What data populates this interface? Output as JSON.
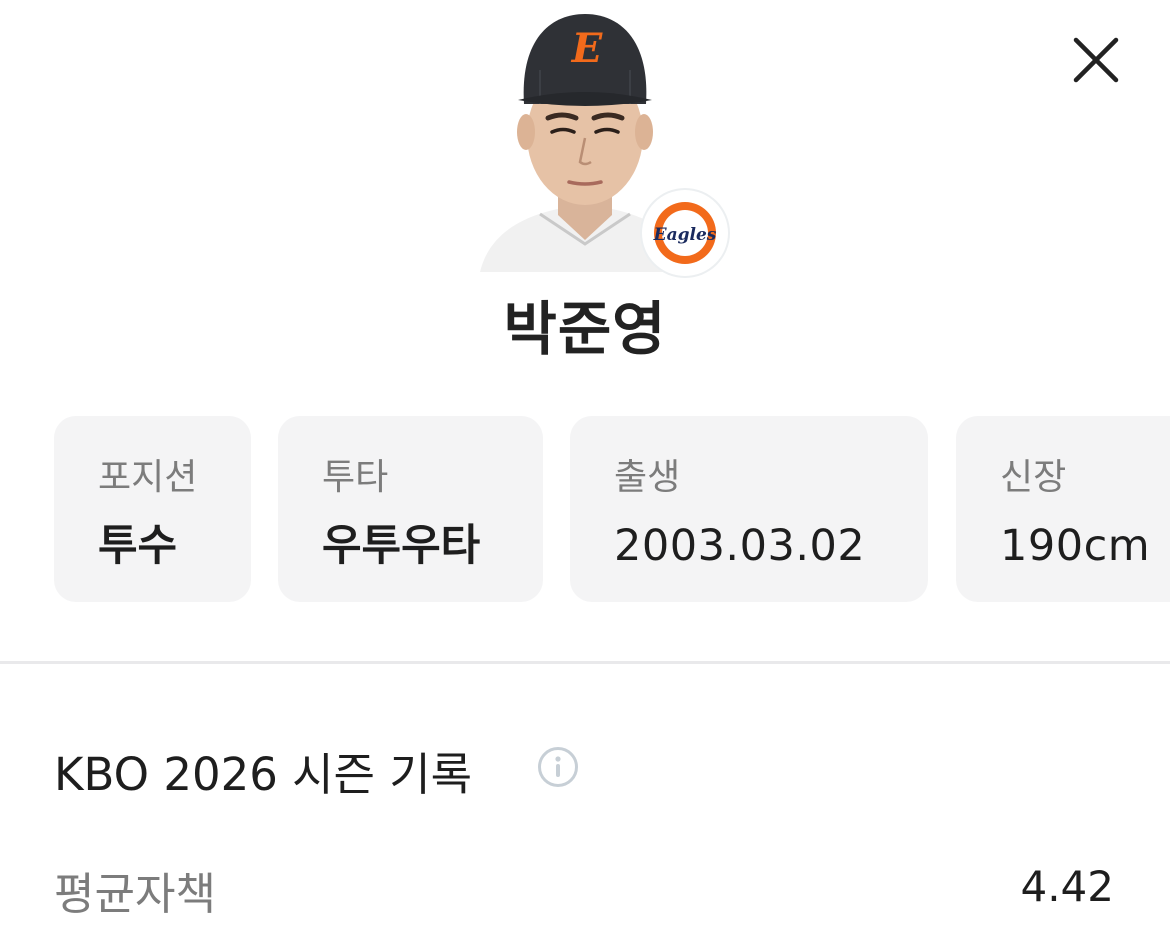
{
  "close_icon": "close-icon",
  "player": {
    "name": "박준영",
    "photo_icon": "player-photo",
    "team_logo_icon": "eagles-logo",
    "team_logo_text": "Eagles",
    "cap_letter": "E",
    "brand_color": "#f26a1b"
  },
  "info_cards": [
    {
      "label": "포지션",
      "value": "투수"
    },
    {
      "label": "투타",
      "value": "우투우타"
    },
    {
      "label": "출생",
      "value": "2003.03.02"
    },
    {
      "label": "신장",
      "value": "190cm"
    }
  ],
  "season": {
    "title": "KBO 2026 시즌 기록",
    "info_icon": "info-icon",
    "stats": [
      {
        "label": "평균자책",
        "value": "4.42"
      }
    ]
  }
}
